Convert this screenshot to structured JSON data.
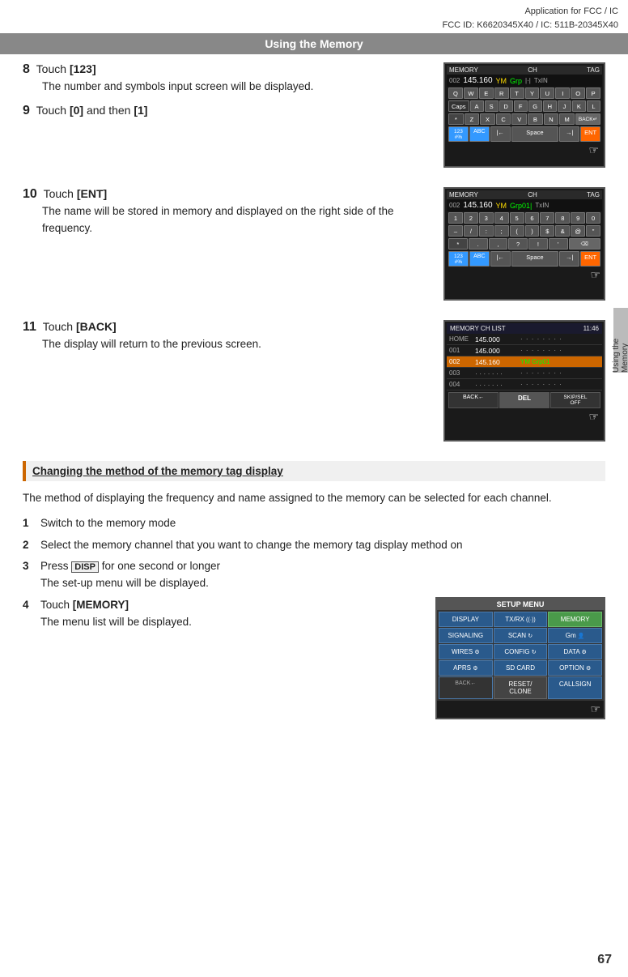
{
  "header": {
    "line1": "Application for FCC / IC",
    "line2": "FCC ID: K6620345X40 / IC: 511B-20345X40"
  },
  "title_bar": "Using the Memory",
  "steps": [
    {
      "num": "8",
      "label": "Touch [123]",
      "body": "The number and symbols input screen will be displayed."
    },
    {
      "num": "9",
      "label": "Touch [0] and then [1]",
      "body": ""
    },
    {
      "num": "10",
      "label": "Touch [ENT]",
      "body": "The name will be stored in memory and displayed on the right side of the frequency."
    },
    {
      "num": "11",
      "label": "Touch [BACK]",
      "body": "The display will return to the previous screen."
    }
  ],
  "screens": {
    "screen1": {
      "top_bar": "MEMORY  CH  TAG",
      "ch": "002",
      "freq": "145.160",
      "ym": "YM",
      "grp": "Grp",
      "txin": "TxIN",
      "rows": [
        "Q W E R T Y U I O P",
        "A S D F G H J K L",
        "* Z X C V B N M BACK",
        "123 ABC ← Space → ENT"
      ]
    },
    "screen2": {
      "top_bar": "MEMORY  CH  TAG",
      "ch": "002",
      "freq": "145.160",
      "ym": "YM",
      "grp": "Grp01",
      "txin": "TxIN",
      "rows": [
        "1 2 3 4 5 6 7 8 9 0",
        "– / : : ( ) $ & @ \"",
        "* . , ? ! ' ⌫",
        "123 ABC ← Space → ENT"
      ]
    },
    "screen3": {
      "title": "MEMORY  CH  LIST",
      "time": "11:46",
      "rows": [
        {
          "ch": "HOME",
          "freq": "145.000",
          "name": "· · · · · · · ·",
          "active": false
        },
        {
          "ch": "001",
          "freq": "145.000",
          "name": "· · · · · · · ·",
          "active": false
        },
        {
          "ch": "002",
          "freq": "145.160",
          "name": "YM Grp01",
          "active": true
        },
        {
          "ch": "003",
          "freq": "· · · · · · ·",
          "name": "· · · · · · · ·",
          "active": false
        },
        {
          "ch": "004",
          "freq": "· · · · · · ·",
          "name": "· · · · · · · ·",
          "active": false
        }
      ],
      "btns": [
        "BACK←",
        "DEL",
        "SKIP/SEL OFF"
      ]
    }
  },
  "section": {
    "title": "Changing the method of the memory tag display",
    "intro": "The method of displaying the frequency and name assigned to the memory can be selected for each channel.",
    "steps": [
      {
        "num": "1",
        "text": "Switch to the memory mode"
      },
      {
        "num": "2",
        "text": "Select the memory channel that you want to change the memory tag display method on"
      },
      {
        "num": "3",
        "text": "Press",
        "key": "DISP",
        "after": "for one second or longer",
        "sub": "The set-up menu will be displayed."
      },
      {
        "num": "4",
        "label": "Touch [MEMORY]",
        "sub": "The menu list will be displayed."
      }
    ]
  },
  "setup_menu": {
    "title": "SETUP MENU",
    "buttons": [
      {
        "label": "DISPLAY",
        "style": "normal"
      },
      {
        "label": "TX/RX",
        "style": "normal"
      },
      {
        "label": "MEMORY",
        "style": "active"
      },
      {
        "label": "SIGNALING",
        "style": "normal"
      },
      {
        "label": "SCAN",
        "style": "normal"
      },
      {
        "label": "Gm",
        "style": "normal"
      },
      {
        "label": "WIRES",
        "style": "normal"
      },
      {
        "label": "CONFIG",
        "style": "normal"
      },
      {
        "label": "DATA",
        "style": "normal"
      },
      {
        "label": "APRS",
        "style": "normal"
      },
      {
        "label": "SD CARD",
        "style": "normal"
      },
      {
        "label": "OPTION",
        "style": "normal"
      },
      {
        "label": "BACK←",
        "style": "back"
      },
      {
        "label": "RESET/CLONE",
        "style": "gray"
      },
      {
        "label": "CALLSIGN",
        "style": "normal"
      }
    ]
  },
  "page_num": "67",
  "side_label": "Using the Memory"
}
